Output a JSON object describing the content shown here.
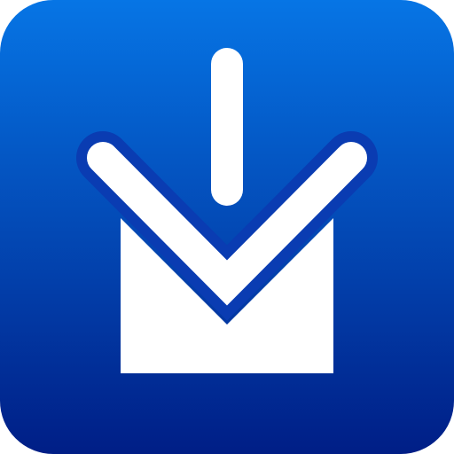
{
  "icon": {
    "name": "download-to-inbox-icon",
    "colors": {
      "background_top": "#0675E5",
      "background_bottom": "#001E86",
      "glyph": "#FFFFFF"
    }
  }
}
